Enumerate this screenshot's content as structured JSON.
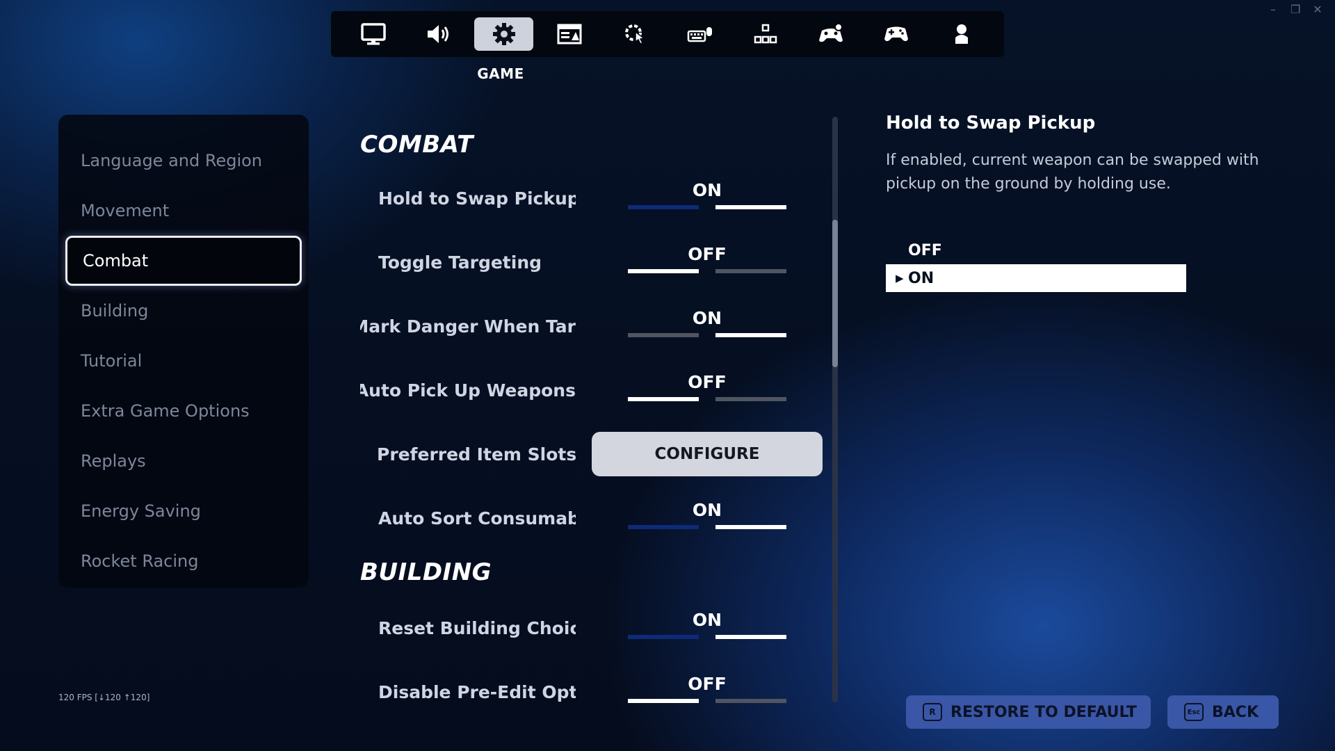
{
  "top_nav": {
    "tabs": [
      {
        "icon": "monitor-icon",
        "active": false
      },
      {
        "icon": "speaker-icon",
        "active": false
      },
      {
        "icon": "gear-icon",
        "active": true
      },
      {
        "icon": "ui-layout-icon",
        "active": false
      },
      {
        "icon": "touch-gear-icon",
        "active": false
      },
      {
        "icon": "keyboard-mouse-icon",
        "active": false
      },
      {
        "icon": "keys-layout-icon",
        "active": false
      },
      {
        "icon": "controller-gear-icon",
        "active": false
      },
      {
        "icon": "controller-icon",
        "active": false
      },
      {
        "icon": "account-icon",
        "active": false
      }
    ],
    "active_caption": "GAME"
  },
  "sidebar": {
    "items": [
      {
        "label": "Language and Region"
      },
      {
        "label": "Movement"
      },
      {
        "label": "Combat",
        "active": true
      },
      {
        "label": "Building"
      },
      {
        "label": "Tutorial"
      },
      {
        "label": "Extra Game Options"
      },
      {
        "label": "Replays"
      },
      {
        "label": "Energy Saving"
      },
      {
        "label": "Rocket Racing"
      }
    ]
  },
  "settings": {
    "combat_title": "COMBAT",
    "building_title": "BUILDING",
    "combat_rows": [
      {
        "label": "Hold to Swap Pickup",
        "value": "ON"
      },
      {
        "label": "Toggle Targeting",
        "value": "OFF"
      },
      {
        "label": "Mark Danger When Tar",
        "value": "ON"
      },
      {
        "label": "Auto Pick Up Weapons",
        "value": "OFF"
      },
      {
        "label": "Preferred Item Slots",
        "button": "CONFIGURE"
      },
      {
        "label": "Auto Sort Consumables",
        "value": "ON"
      }
    ],
    "building_rows": [
      {
        "label": "Reset Building Choice",
        "value": "ON"
      },
      {
        "label": "Disable Pre-Edit Option",
        "value": "OFF"
      }
    ]
  },
  "detail": {
    "title": "Hold to Swap Pickup",
    "description": "If enabled, current weapon can be swapped with pickup on the ground by holding use.",
    "options": [
      "OFF",
      "ON"
    ],
    "selected_option": "ON"
  },
  "footer": {
    "fps": "120 FPS [↓120 ↑120]",
    "restore_key": "R",
    "restore_label": "RESTORE TO DEFAULT",
    "back_key": "Esc",
    "back_label": "BACK"
  },
  "colors": {
    "toggle_selected_bar": "#0e2a78",
    "toggle_on_bar": "#ffffff",
    "bottom_button": "#3a56a6"
  }
}
